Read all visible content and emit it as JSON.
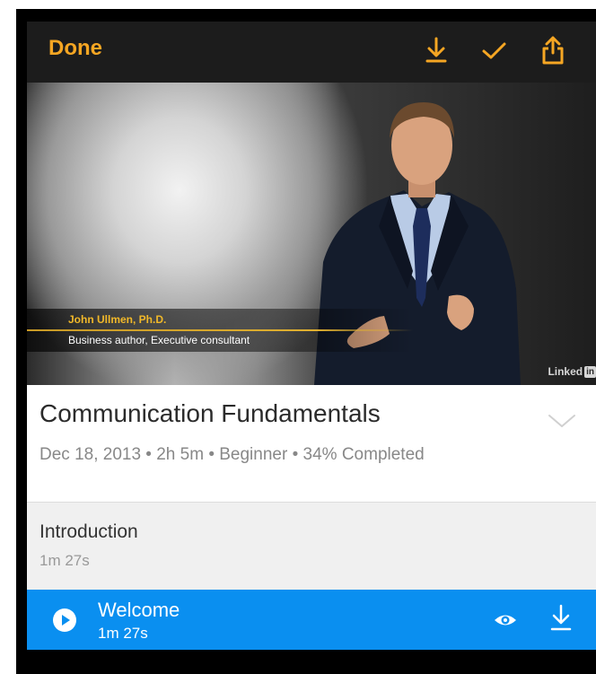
{
  "colors": {
    "accent": "#f5a623",
    "topbar_bg": "#1c1c1c",
    "lesson_bg": "#0a8ff0",
    "section_bg": "#f0f0f0"
  },
  "topbar": {
    "done_label": "Done",
    "icons": [
      "download-icon",
      "checkmark-icon",
      "share-icon"
    ]
  },
  "video": {
    "presenter_name": "John Ullmen, Ph.D.",
    "presenter_role": "Business author, Executive consultant",
    "watermark_text": "Linked",
    "watermark_box": "in"
  },
  "course": {
    "title": "Communication Fundamentals",
    "meta": "Dec 18, 2013 • 2h 5m • Beginner • 34% Completed"
  },
  "section": {
    "title": "Introduction",
    "duration": "1m 27s"
  },
  "lesson": {
    "title": "Welcome",
    "duration": "1m 27s",
    "icons": [
      "play-icon",
      "eye-icon",
      "download-icon"
    ]
  }
}
